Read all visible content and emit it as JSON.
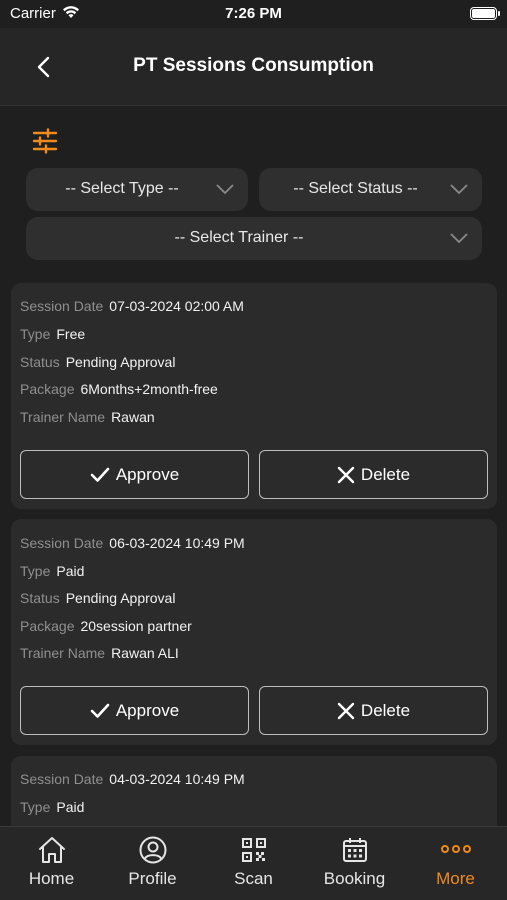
{
  "status_bar": {
    "carrier": "Carrier",
    "time": "7:26 PM"
  },
  "header": {
    "title": "PT Sessions Consumption",
    "back_icon": "chevron-left-icon"
  },
  "filters": {
    "icon": "sliders-icon",
    "type_placeholder": "-- Select Type --",
    "status_placeholder": "-- Select Status --",
    "trainer_placeholder": "-- Select Trainer --"
  },
  "labels": {
    "session_date": "Session Date",
    "type": "Type",
    "status": "Status",
    "package": "Package",
    "trainer_name": "Trainer Name",
    "approve": "Approve",
    "delete": "Delete"
  },
  "sessions": [
    {
      "session_date": "07-03-2024 02:00 AM",
      "type": "Free",
      "status": "Pending Approval",
      "package": "6Months+2month-free",
      "trainer_name": "Rawan"
    },
    {
      "session_date": "06-03-2024 10:49 PM",
      "type": "Paid",
      "status": "Pending Approval",
      "package": "20session partner",
      "trainer_name": "Rawan ALI"
    },
    {
      "session_date": "04-03-2024 10:49 PM",
      "type": "Paid"
    }
  ],
  "tabbar": {
    "items": [
      {
        "label": "Home",
        "icon": "home-icon"
      },
      {
        "label": "Profile",
        "icon": "user-circle-icon"
      },
      {
        "label": "Scan",
        "icon": "qr-code-icon"
      },
      {
        "label": "Booking",
        "icon": "calendar-icon"
      },
      {
        "label": "More",
        "icon": "more-dots-icon",
        "active": true
      }
    ]
  },
  "colors": {
    "accent": "#f08a1c",
    "background": "#1f1f1f",
    "card": "#2b2b2b"
  }
}
